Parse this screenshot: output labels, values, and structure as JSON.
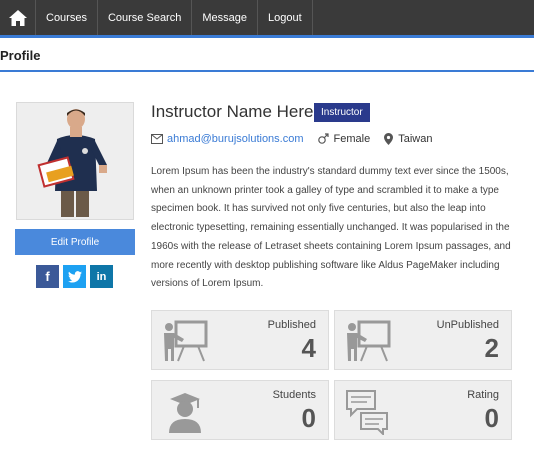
{
  "nav": {
    "home_icon": "home-icon",
    "items": [
      {
        "label": "Courses"
      },
      {
        "label": "Course Search"
      },
      {
        "label": "Message"
      },
      {
        "label": "Logout"
      }
    ]
  },
  "page": {
    "title": "Profile"
  },
  "profile": {
    "name": "Instructor Name Here",
    "role": "Instructor",
    "email": "ahmad@burujsolutions.com",
    "gender": "Female",
    "location": "Taiwan",
    "bio": "Lorem Ipsum has been the industry's standard dummy text ever since the 1500s, when an unknown printer took a galley of type and scrambled it to make a type specimen book. It has survived not only five centuries, but also the leap into electronic typesetting, remaining essentially unchanged. It was popularised in the 1960s with the release of Letraset sheets containing Lorem Ipsum passages, and more recently with desktop publishing software like Aldus PageMaker including versions of Lorem Ipsum.",
    "edit_label": "Edit Profile",
    "social": {
      "facebook": "f",
      "twitter": "t",
      "linkedin": "in"
    }
  },
  "stats": [
    {
      "label": "Published",
      "value": "4",
      "icon": "presentation-icon"
    },
    {
      "label": "UnPublished",
      "value": "2",
      "icon": "presentation-icon"
    },
    {
      "label": "Students",
      "value": "0",
      "icon": "graduate-icon"
    },
    {
      "label": "Rating",
      "value": "0",
      "icon": "chat-bubbles-icon"
    }
  ],
  "colors": {
    "navbar": "#3a3a3a",
    "accent": "#3a7bd5",
    "badge": "#2a3a8c",
    "button": "#4a89dc"
  }
}
